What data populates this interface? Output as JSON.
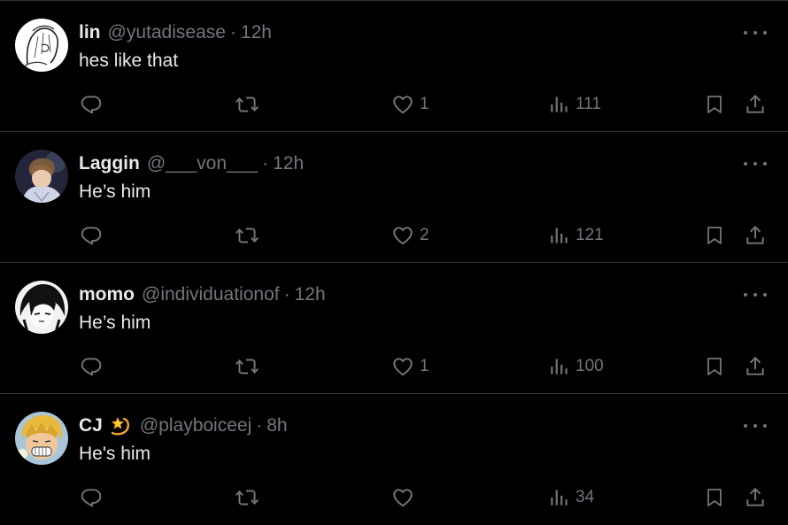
{
  "colors": {
    "background": "#000000",
    "text": "#e7e9ea",
    "muted": "#71767b",
    "divider": "#2f3336"
  },
  "tweets": [
    {
      "name": "lin",
      "handle": "@yutadisease",
      "separator": "·",
      "time": "12h",
      "text": "hes like that",
      "likes": "1",
      "views": "111",
      "avatar": "sketch-portrait"
    },
    {
      "name": "Laggin",
      "handle": "@___von___",
      "separator": "·",
      "time": "12h",
      "text": "He’s him",
      "likes": "2",
      "views": "121",
      "avatar": "anime-portrait"
    },
    {
      "name": "momo",
      "handle": "@individuationof",
      "separator": "·",
      "time": "12h",
      "text": "He’s him",
      "likes": "1",
      "views": "100",
      "avatar": "manga-portrait"
    },
    {
      "name": "CJ",
      "emoji": "dizzy-star-emoji",
      "handle": "@playboiceej",
      "separator": "·",
      "time": "8h",
      "text": "He's him",
      "likes": "",
      "views": "34",
      "avatar": "cartoon-portrait"
    }
  ],
  "icons": {
    "reply": "reply-icon",
    "retweet": "retweet-icon",
    "like": "heart-icon",
    "views": "views-icon",
    "bookmark": "bookmark-icon",
    "share": "share-icon",
    "more": "more-icon"
  }
}
